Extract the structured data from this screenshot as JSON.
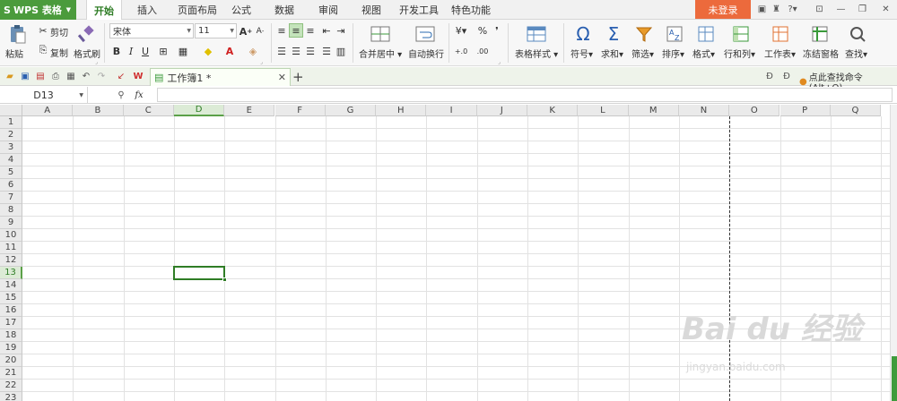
{
  "app": {
    "name": "WPS 表格"
  },
  "menu": {
    "tabs": [
      {
        "label": "开始",
        "active": true
      },
      {
        "label": "插入"
      },
      {
        "label": "页面布局"
      },
      {
        "label": "公式"
      },
      {
        "label": "数据"
      },
      {
        "label": "审阅"
      },
      {
        "label": "视图"
      },
      {
        "label": "开发工具"
      },
      {
        "label": "特色功能"
      }
    ],
    "login_label": "未登录"
  },
  "ribbon": {
    "paste": "粘贴",
    "cut": "剪切",
    "copy": "复制",
    "format_painter": "格式刷",
    "font_name": "宋体",
    "font_size": "11",
    "bold": "B",
    "italic": "I",
    "underline": "U",
    "merge_center": "合并居中",
    "wrap_text": "自动换行",
    "percent": "%",
    "thousands": "000",
    "table_style": "表格样式",
    "symbol": "符号",
    "sum": "求和",
    "filter": "筛选",
    "sort": "排序",
    "format": "格式",
    "row_col": "行和列",
    "worksheet": "工作表",
    "freeze": "冻结窗格",
    "find": "查找",
    "font_grow": "A",
    "font_shrink": "A",
    "font_color": "A"
  },
  "quickbar": {
    "doc_tab": "工作簿1 *",
    "find_command": "点此查找命令 (Alt+Q)"
  },
  "formula_bar": {
    "name_box": "D13",
    "fx": "fx",
    "value": ""
  },
  "sheet": {
    "columns": [
      "A",
      "B",
      "C",
      "D",
      "E",
      "F",
      "G",
      "H",
      "I",
      "J",
      "K",
      "L",
      "M",
      "N",
      "O",
      "P",
      "Q"
    ],
    "rows": [
      "1",
      "2",
      "3",
      "4",
      "5",
      "6",
      "7",
      "8",
      "9",
      "10",
      "11",
      "12",
      "13",
      "14",
      "15",
      "16",
      "17",
      "18",
      "19",
      "20",
      "21",
      "22",
      "23"
    ],
    "selected_column": "D",
    "selected_row": "13"
  },
  "watermark": {
    "brand": "Bai du 经验",
    "url": "jingyan.baidu.com"
  },
  "colors": {
    "accent_green": "#4b9b3c",
    "selection_green": "#2f7d26",
    "login_orange": "#ec6a3c"
  }
}
